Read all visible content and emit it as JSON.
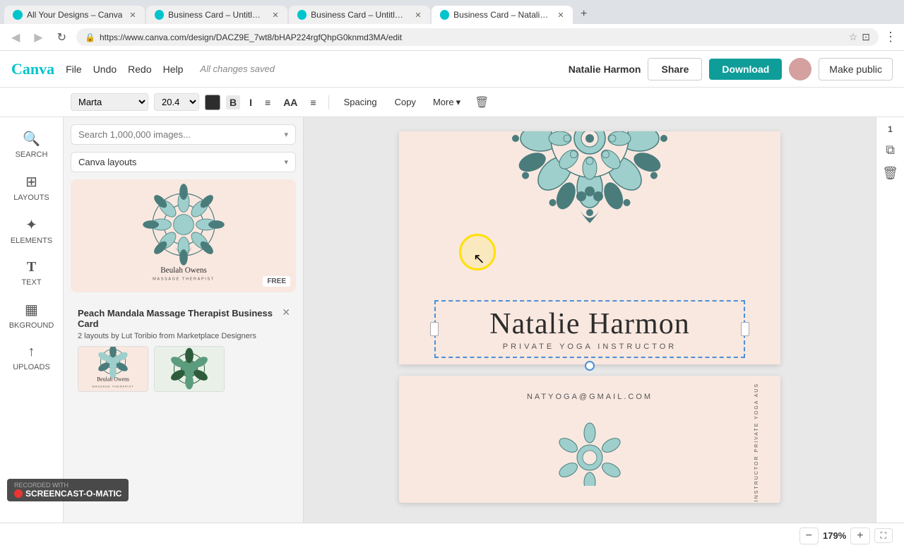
{
  "browser": {
    "tabs": [
      {
        "label": "All Your Designs – Canva",
        "active": false,
        "favicon_color": "#00c4cc"
      },
      {
        "label": "Business Card – Untitled...",
        "active": false,
        "favicon_color": "#00c4cc"
      },
      {
        "label": "Business Card – Untitled...",
        "active": false,
        "favicon_color": "#00c4cc"
      },
      {
        "label": "Business Card – Natalie ...",
        "active": true,
        "favicon_color": "#00c4cc"
      }
    ],
    "address": "https://www.canva.com/design/DACZ9E_7wt8/bHAP224rgfQhpG0knmd3MA/edit",
    "secure_label": "Secure"
  },
  "header": {
    "logo": "Canva",
    "menu": [
      "File",
      "Undo",
      "Redo",
      "Help"
    ],
    "saved_text": "All changes saved",
    "user_name": "Natalie Harmon",
    "share_label": "Share",
    "download_label": "Download",
    "public_label": "Make public"
  },
  "format_bar": {
    "font_family": "Marta",
    "font_size": "20.4",
    "bold_label": "B",
    "italic_label": "I",
    "align_label": "≡",
    "case_label": "AA",
    "list_label": "≡",
    "spacing_label": "Spacing",
    "copy_label": "Copy",
    "more_label": "More",
    "trash_label": "🗑"
  },
  "sidebar": {
    "items": [
      {
        "id": "search",
        "label": "SEARCH",
        "icon": "🔍"
      },
      {
        "id": "layouts",
        "label": "LAYOUTS",
        "icon": "⊞"
      },
      {
        "id": "elements",
        "label": "ELEMENTS",
        "icon": "✦"
      },
      {
        "id": "text",
        "label": "TEXT",
        "icon": "T"
      },
      {
        "id": "background",
        "label": "BKGROUND",
        "icon": "▦"
      },
      {
        "id": "uploads",
        "label": "UPLOADS",
        "icon": "↑"
      }
    ]
  },
  "content_panel": {
    "search_placeholder": "Search 1,000,000 images...",
    "layout_label": "Canva layouts",
    "template": {
      "title": "Peach Mandala Massage Therapist Business Card",
      "meta": "2 layouts by Lut Toribio from Marketplace Designers",
      "free_badge": "FREE"
    }
  },
  "canvas": {
    "main_name": "Natalie Harmon",
    "sub_title": "PRIVATE YOGA INSTRUCTOR",
    "email": "NATYOGA@GMAIL.COM",
    "card_bg": "#f9e8e0"
  },
  "right_panel": {
    "page_number": "1"
  },
  "bottom_bar": {
    "zoom_level": "179%",
    "zoom_minus": "−",
    "zoom_plus": "+"
  },
  "screencast": {
    "label": "RECORDED WITH",
    "app": "SCREENCAST-O-MATIC"
  }
}
